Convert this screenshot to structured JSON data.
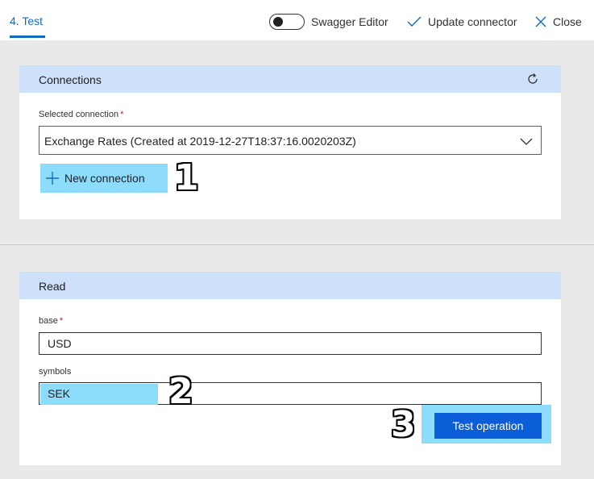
{
  "header": {
    "active_tab": "4. Test",
    "swagger_label": "Swagger Editor",
    "update_label": "Update connector",
    "close_label": "Close"
  },
  "connections": {
    "title": "Connections",
    "selected_label": "Selected connection",
    "required_mark": "*",
    "selected_value": "Exchange Rates (Created at 2019-12-27T18:37:16.0020203Z)",
    "new_connection_label": "New connection"
  },
  "read": {
    "title": "Read",
    "base_label": "base",
    "required_mark": "*",
    "base_value": "USD",
    "symbols_label": "symbols",
    "symbols_value": "SEK",
    "test_label": "Test operation"
  },
  "annotations": {
    "one": "1",
    "two": "2",
    "three": "3"
  },
  "colors": {
    "accent": "#0f6cbd",
    "header_bg": "#cfe0fb",
    "highlight": "#8ddcfb",
    "primary_button": "#0b5ed7"
  },
  "icons": {
    "toggle": "toggle-switch-off",
    "update": "checkmark-icon",
    "close": "close-icon",
    "refresh": "refresh-icon",
    "chevron": "chevron-down-icon",
    "add": "plus-icon"
  }
}
